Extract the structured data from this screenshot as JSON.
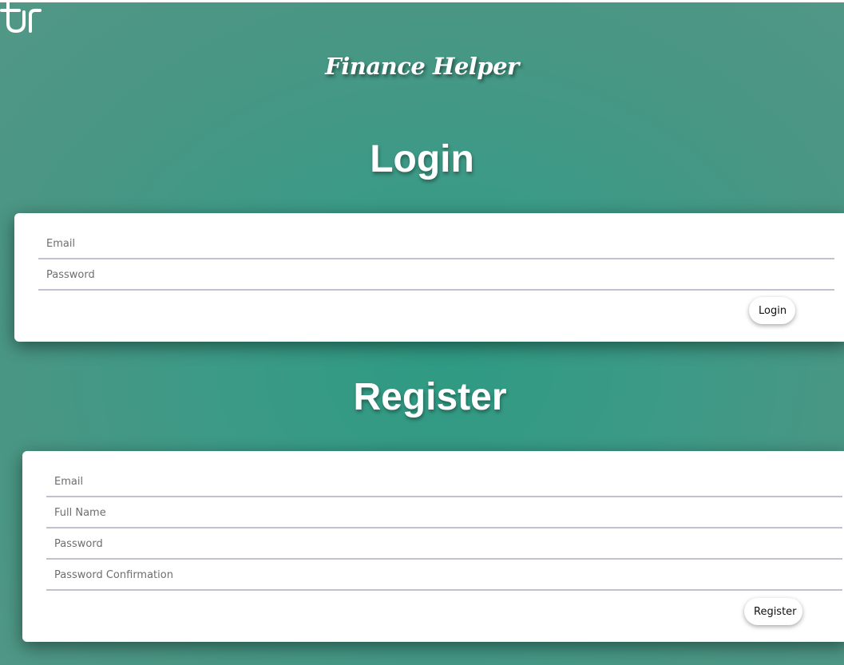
{
  "brand": {
    "title": "Finance Helper"
  },
  "login": {
    "heading": "Login",
    "email_placeholder": "Email",
    "password_placeholder": "Password",
    "submit_label": "Login"
  },
  "register": {
    "heading": "Register",
    "email_placeholder": "Email",
    "fullname_placeholder": "Full Name",
    "password_placeholder": "Password",
    "password_confirmation_placeholder": "Password Confirmation",
    "submit_label": "Register"
  },
  "icons": {
    "logo": "brand-logo-icon"
  },
  "colors": {
    "background": "#3b9a86",
    "card": "#ffffff",
    "field_underline": "#c3c0cf",
    "heading_text": "#ffffff"
  }
}
